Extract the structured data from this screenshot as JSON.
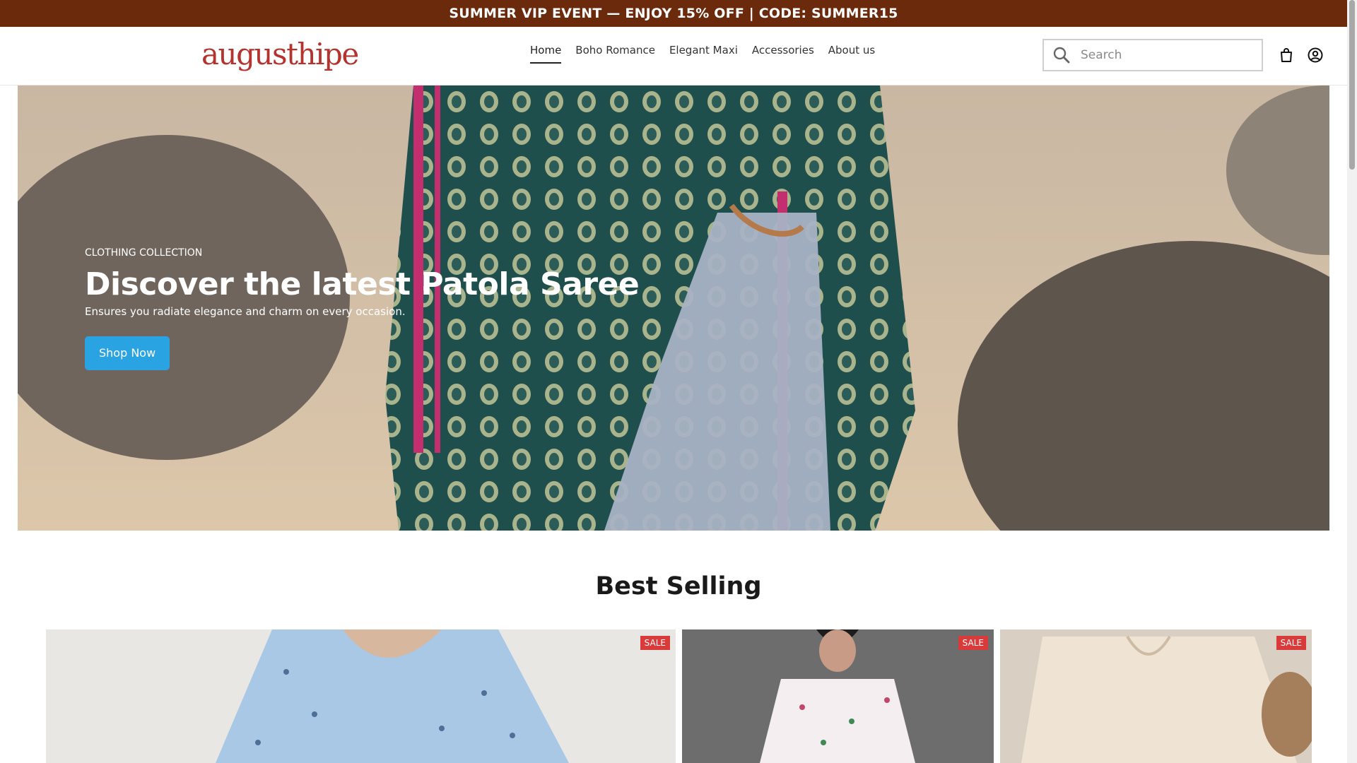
{
  "announcement": "SUMMER VIP EVENT — ENJOY 15% OFF | CODE: SUMMER15",
  "header": {
    "logo": "augusthipe",
    "nav": [
      {
        "label": "Home",
        "active": true
      },
      {
        "label": "Boho Romance",
        "active": false
      },
      {
        "label": "Elegant Maxi",
        "active": false
      },
      {
        "label": "Accessories",
        "active": false
      },
      {
        "label": "About us",
        "active": false
      }
    ],
    "search_placeholder": "Search",
    "icons": [
      "search-icon",
      "shopping-bag-icon",
      "account-icon"
    ]
  },
  "hero": {
    "eyebrow": "CLOTHING COLLECTION",
    "headline": "Discover the latest Patola Saree",
    "subtext": "Ensures you radiate elegance and charm on every occasion.",
    "button": "Shop Now"
  },
  "best_selling": {
    "title": "Best Selling",
    "products": [
      {
        "badge": "SALE"
      },
      {
        "badge": "SALE"
      },
      {
        "badge": "SALE"
      }
    ]
  },
  "colors": {
    "announcement_bg": "#6b2a0c",
    "logo": "#b5332e",
    "button": "#2aa3e3",
    "sale_badge": "#d93a3a"
  }
}
